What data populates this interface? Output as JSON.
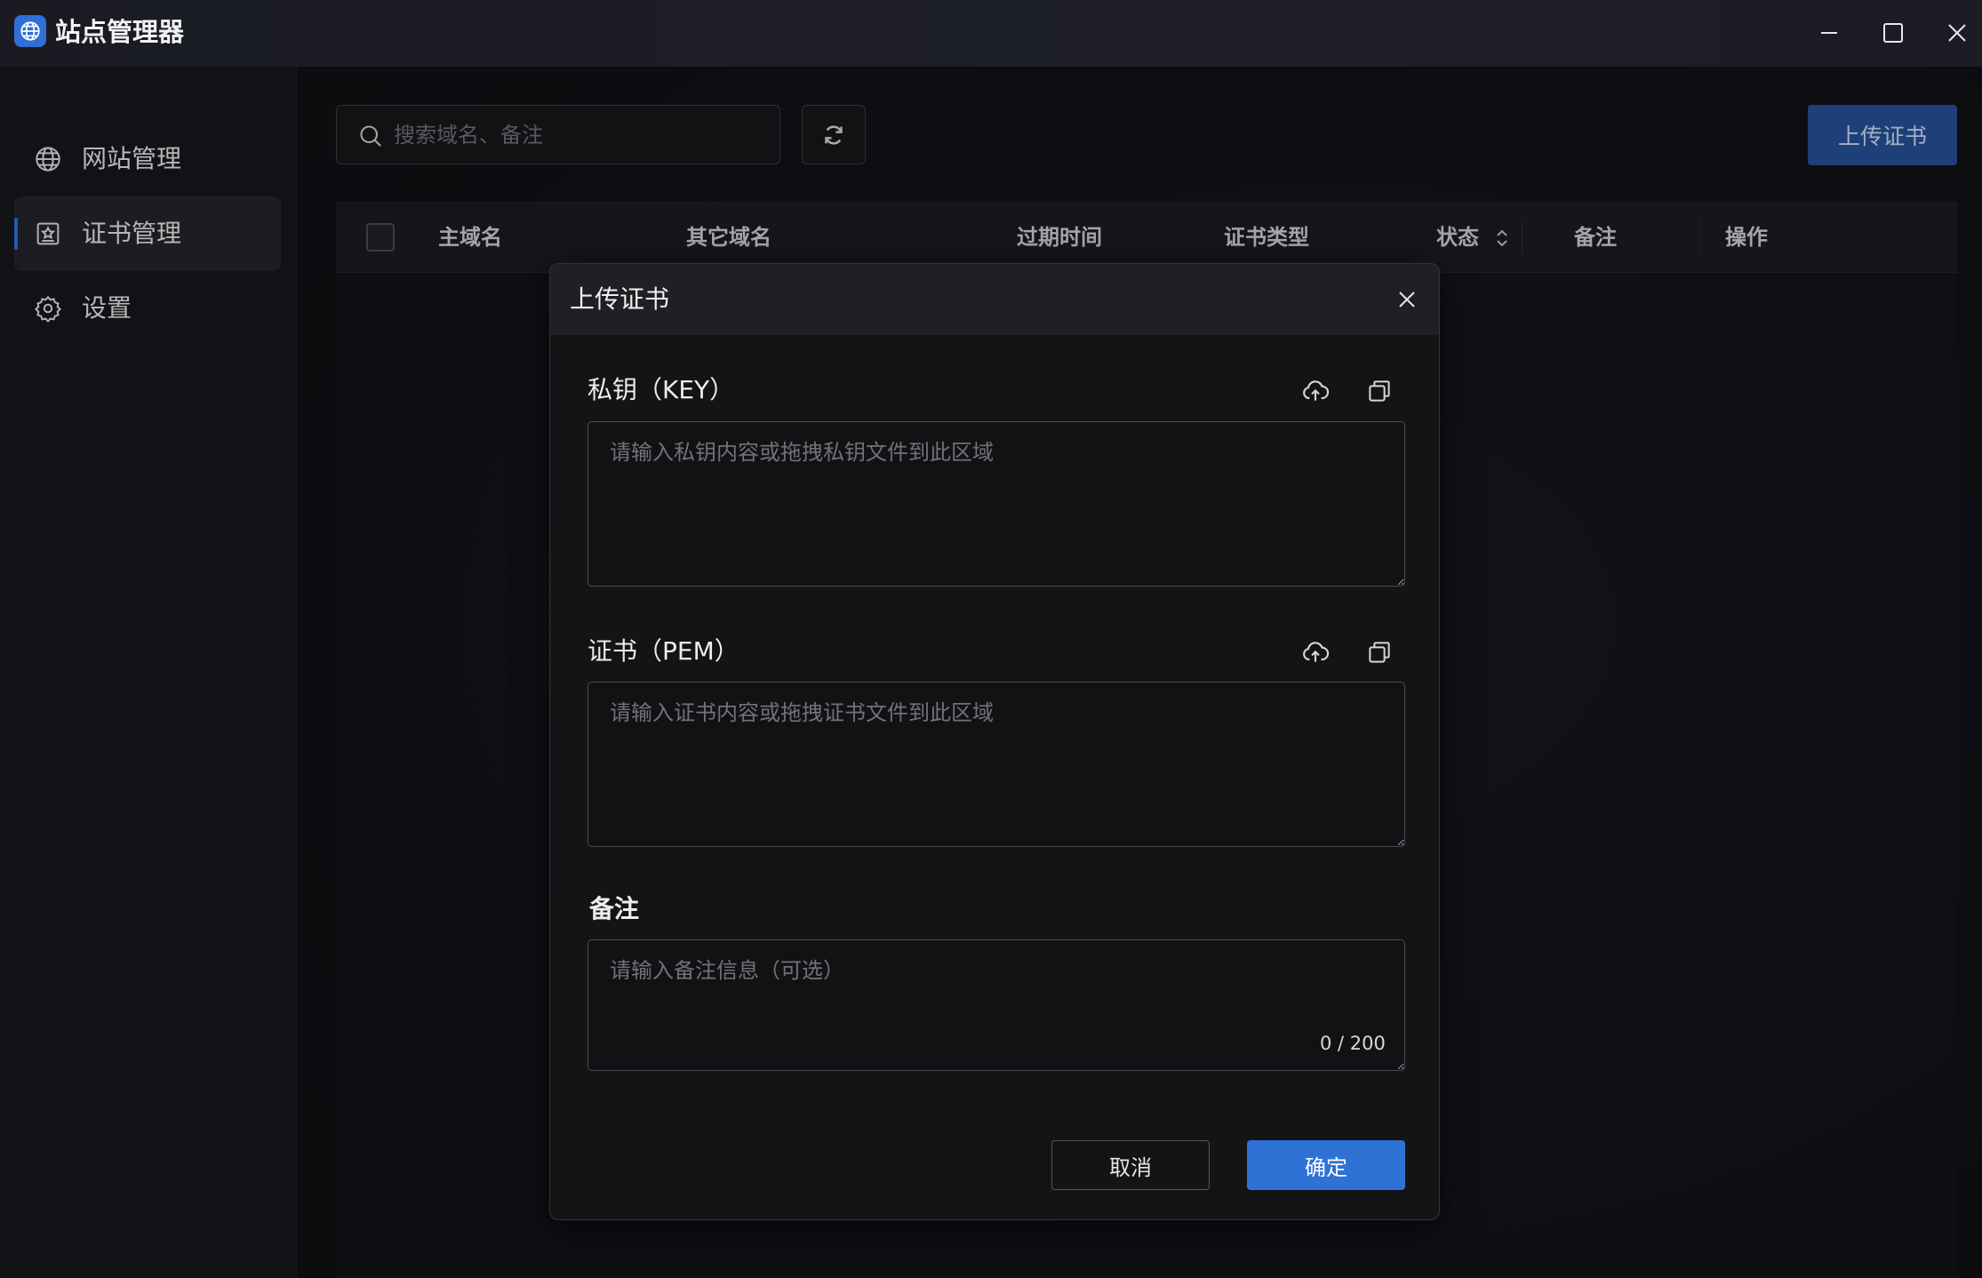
{
  "app": {
    "title": "站点管理器",
    "accent_color": "#2f6fd6",
    "logo_icon": "globe-icon"
  },
  "window_controls": {
    "minimize_icon": "minimize-icon",
    "maximize_icon": "maximize-icon",
    "close_icon": "close-icon"
  },
  "sidebar": {
    "items": [
      {
        "label": "网站管理",
        "icon": "globe-icon",
        "active": false
      },
      {
        "label": "证书管理",
        "icon": "certificate-icon",
        "active": true
      },
      {
        "label": "设置",
        "icon": "gear-icon",
        "active": false
      }
    ]
  },
  "toolbar": {
    "search_placeholder": "搜索域名、备注",
    "refresh_icon": "refresh-icon",
    "upload_label": "上传证书"
  },
  "table": {
    "columns": [
      "主域名",
      "其它域名",
      "过期时间",
      "证书类型",
      "状态",
      "备注",
      "操作"
    ],
    "sortable_column": "状态",
    "rows": []
  },
  "modal": {
    "title": "上传证书",
    "key_field": {
      "label": "私钥（KEY）",
      "placeholder": "请输入私钥内容或拖拽私钥文件到此区域",
      "value": ""
    },
    "pem_field": {
      "label": "证书（PEM）",
      "placeholder": "请输入证书内容或拖拽证书文件到此区域",
      "value": ""
    },
    "remark_field": {
      "label": "备注",
      "placeholder": "请输入备注信息（可选）",
      "value": "",
      "counter": "0 / 200"
    },
    "cancel_label": "取消",
    "confirm_label": "确定"
  }
}
